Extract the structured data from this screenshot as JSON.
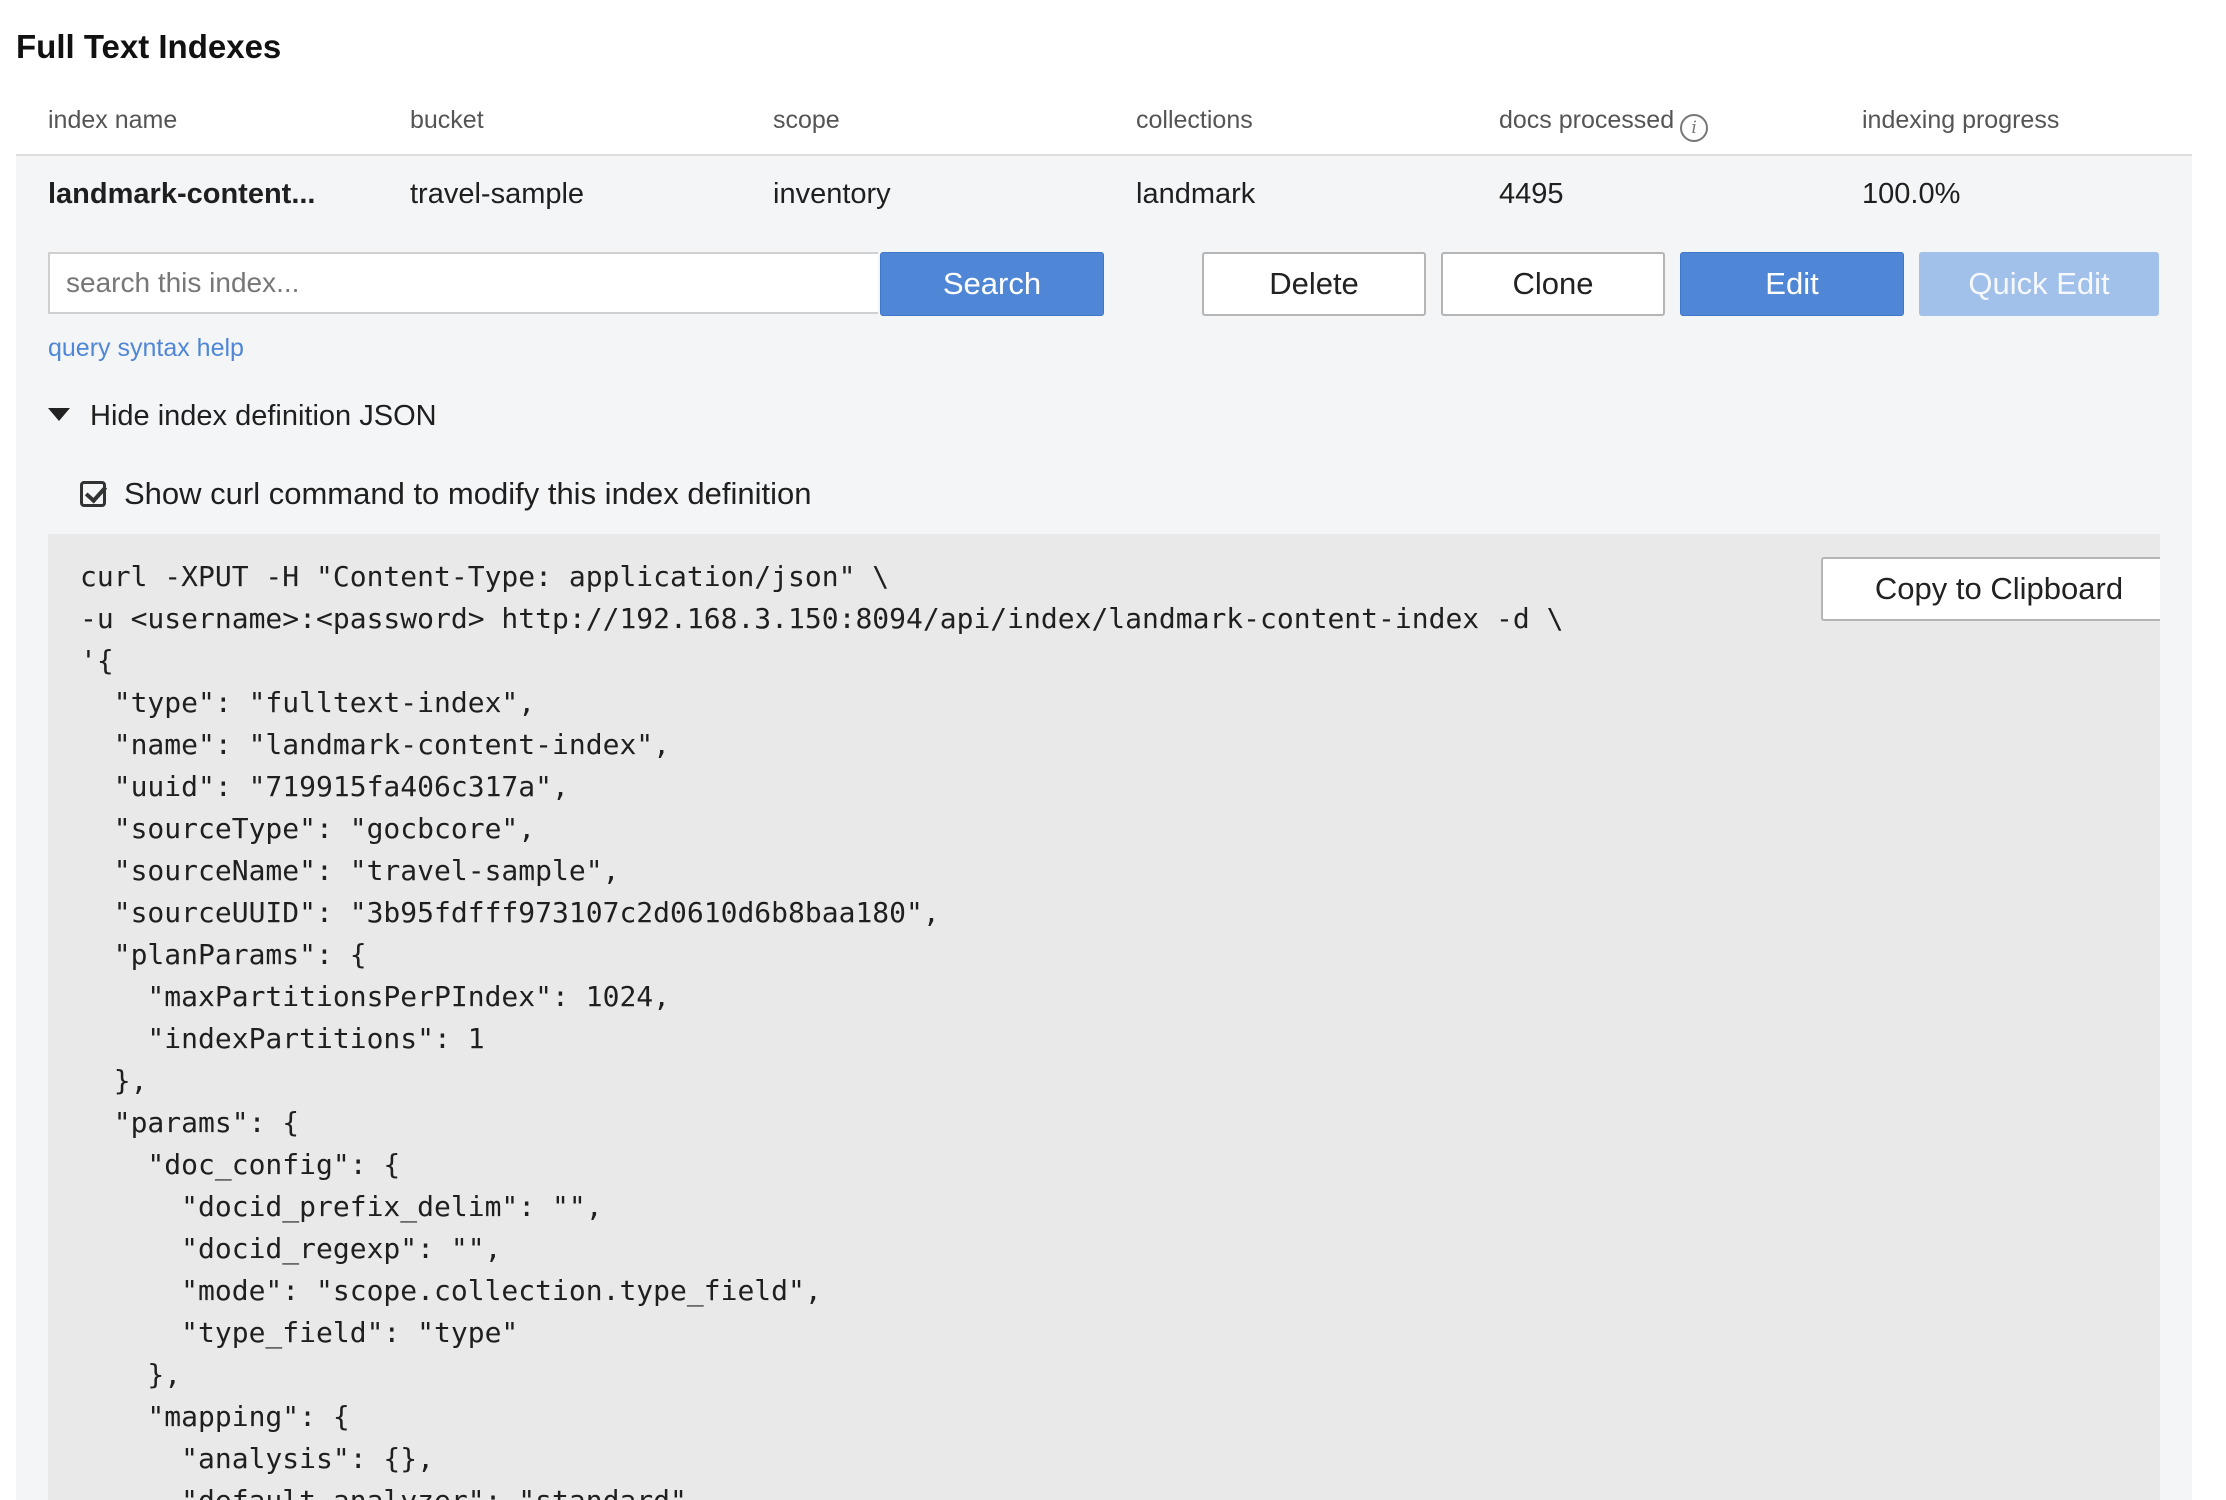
{
  "page": {
    "title": "Full Text Indexes"
  },
  "table": {
    "headers": {
      "index_name": "index name",
      "bucket": "bucket",
      "scope": "scope",
      "collections": "collections",
      "docs_processed": "docs processed",
      "indexing_progress": "indexing progress"
    },
    "row": {
      "index_name": "landmark-content...",
      "bucket": "travel-sample",
      "scope": "inventory",
      "collections": "landmark",
      "docs_processed": "4495",
      "indexing_progress": "100.0%"
    }
  },
  "search": {
    "placeholder": "search this index...",
    "value": "",
    "button_label": "Search"
  },
  "actions": {
    "delete": "Delete",
    "clone": "Clone",
    "edit": "Edit",
    "quick_edit": "Quick Edit"
  },
  "links": {
    "query_help": "query syntax help"
  },
  "json_section": {
    "toggle_label": "Hide index definition JSON",
    "curl_checkbox_label": "Show curl command to modify this index definition",
    "curl_checked": true,
    "copy_button": "Copy to Clipboard",
    "code": "curl -XPUT -H \"Content-Type: application/json\" \\\n-u <username>:<password> http://192.168.3.150:8094/api/index/landmark-content-index -d \\\n'{\n  \"type\": \"fulltext-index\",\n  \"name\": \"landmark-content-index\",\n  \"uuid\": \"719915fa406c317a\",\n  \"sourceType\": \"gocbcore\",\n  \"sourceName\": \"travel-sample\",\n  \"sourceUUID\": \"3b95fdfff973107c2d0610d6b8baa180\",\n  \"planParams\": {\n    \"maxPartitionsPerPIndex\": 1024,\n    \"indexPartitions\": 1\n  },\n  \"params\": {\n    \"doc_config\": {\n      \"docid_prefix_delim\": \"\",\n      \"docid_regexp\": \"\",\n      \"mode\": \"scope.collection.type_field\",\n      \"type_field\": \"type\"\n    },\n    \"mapping\": {\n      \"analysis\": {},\n      \"default_analyzer\": \"standard\","
  },
  "icons": {
    "info": "info-icon",
    "caret": "caret-down-icon",
    "checkbox": "checkbox-checked-icon"
  }
}
